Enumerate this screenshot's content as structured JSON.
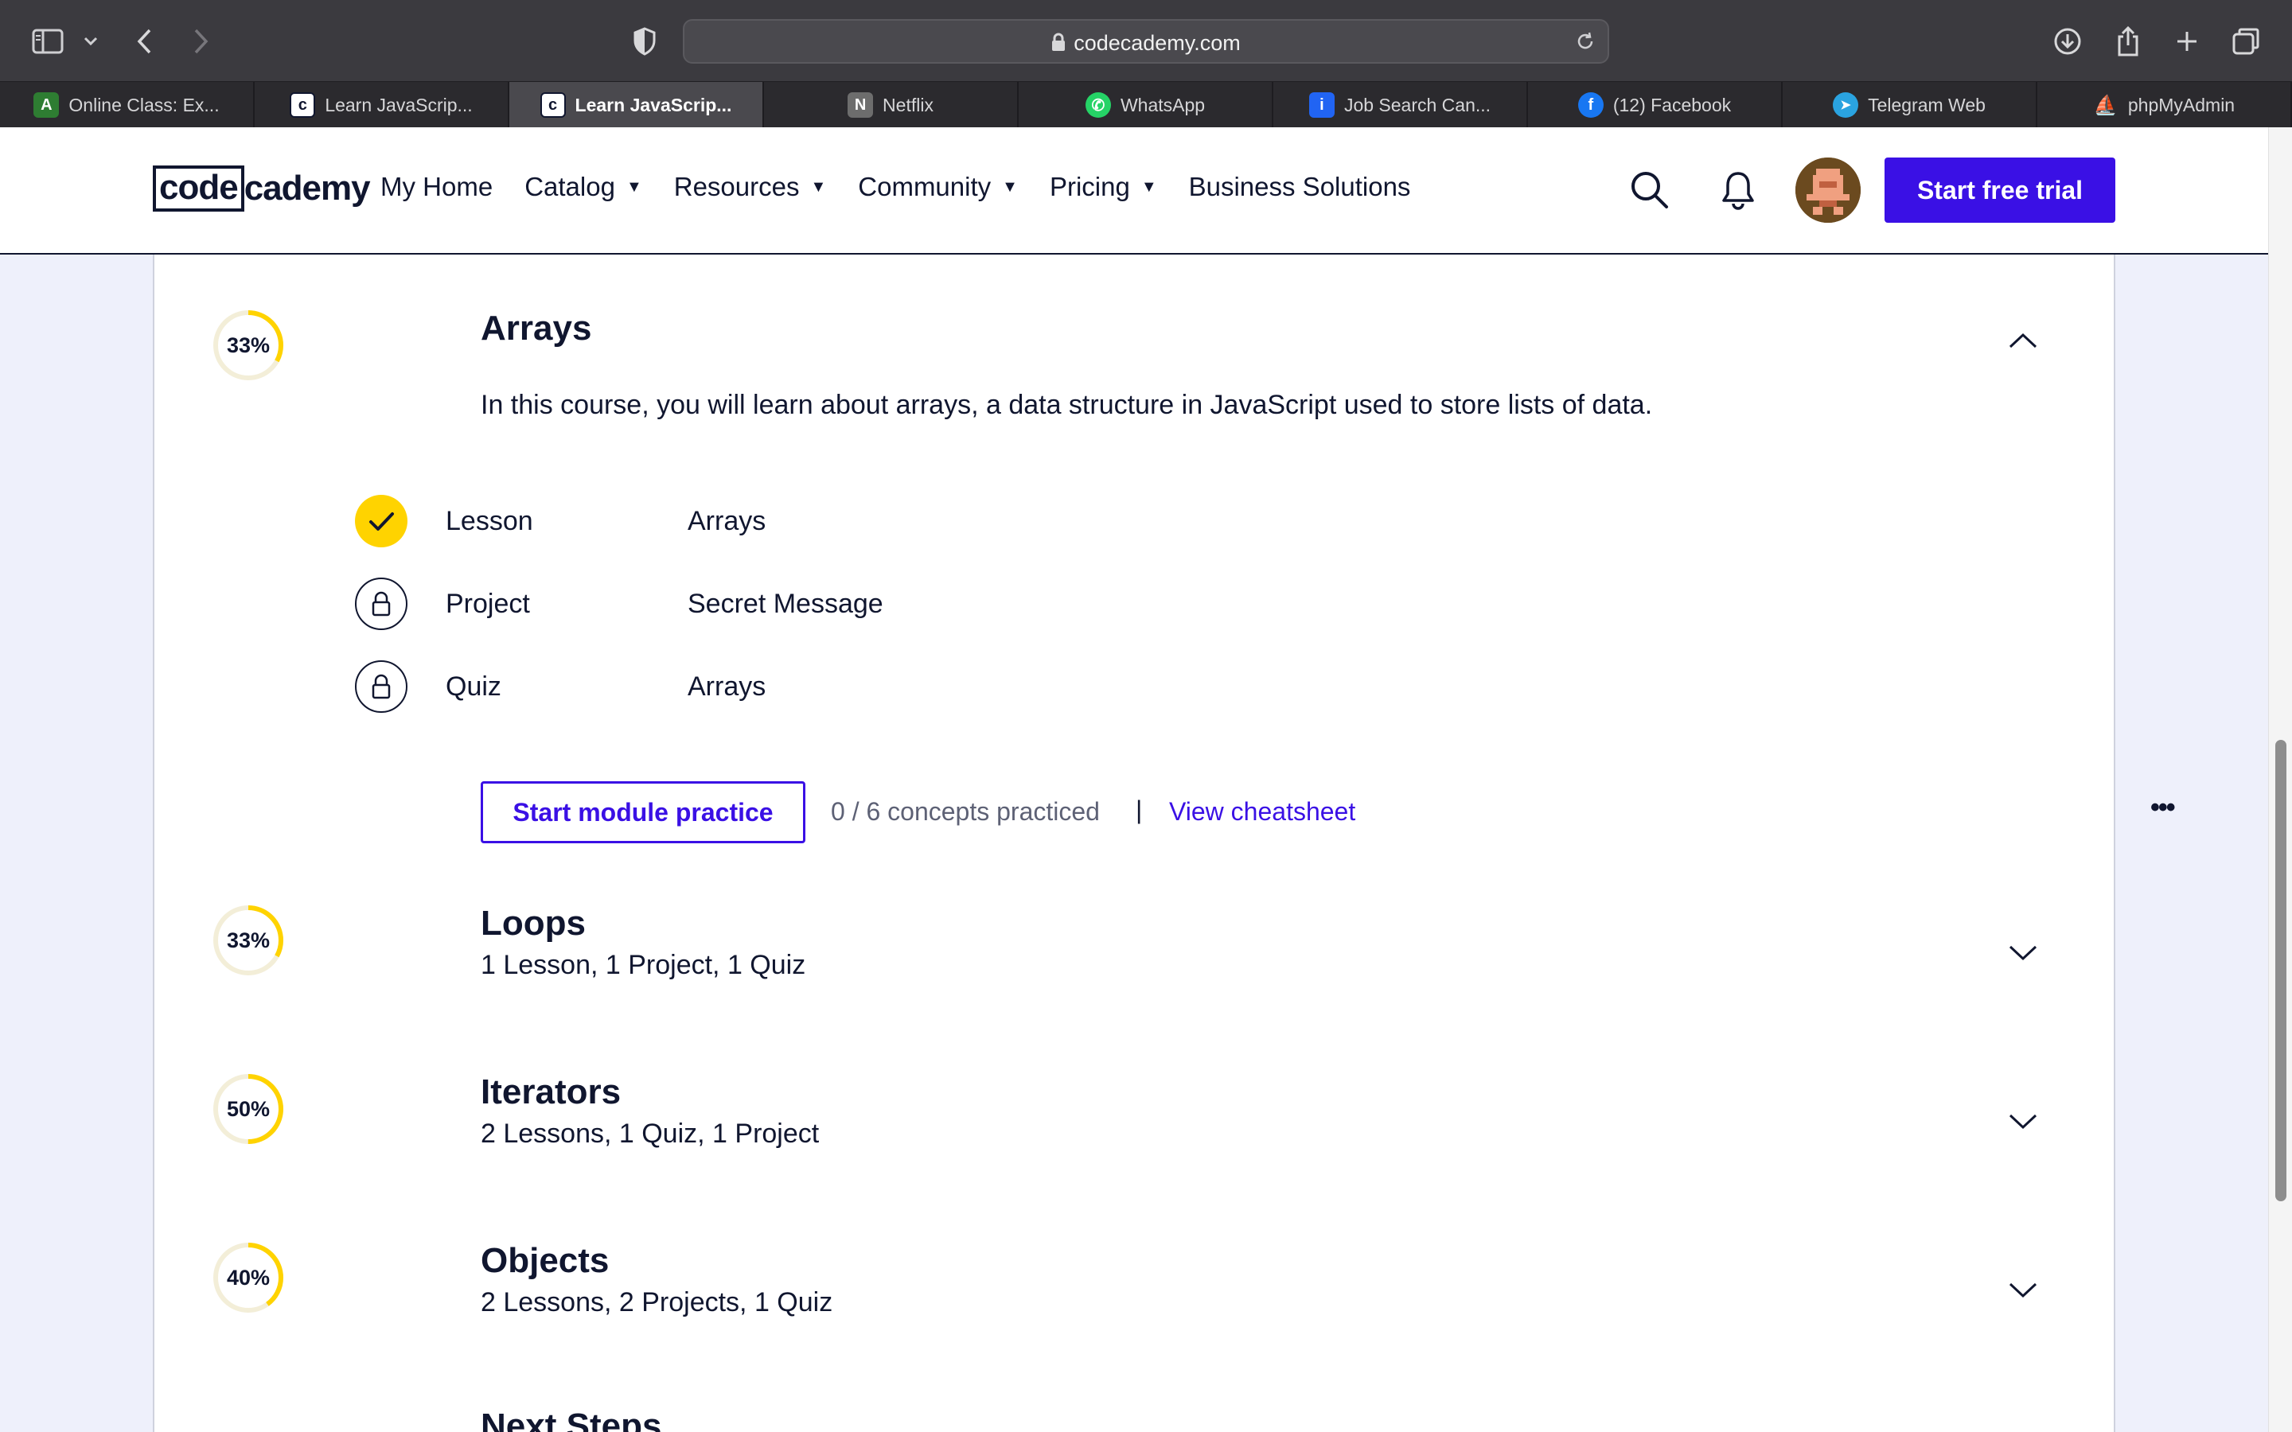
{
  "browser": {
    "url": "codecademy.com",
    "tabs": [
      {
        "label": "Online Class: Ex...",
        "favicon": "online-class-favicon",
        "color": "#2e7d32",
        "glyph": "A"
      },
      {
        "label": "Learn JavaScrip...",
        "favicon": "codecademy-favicon",
        "color": "#ffffff",
        "glyph": "c"
      },
      {
        "label": "Learn JavaScrip...",
        "favicon": "codecademy-favicon",
        "color": "#ffffff",
        "glyph": "c",
        "active": true
      },
      {
        "label": "Netflix",
        "favicon": "netflix-favicon",
        "color": "#6d6d6d",
        "glyph": "N"
      },
      {
        "label": "WhatsApp",
        "favicon": "whatsapp-favicon",
        "color": "#25d366",
        "glyph": "✆"
      },
      {
        "label": "Job Search Can...",
        "favicon": "indeed-favicon",
        "color": "#2164f3",
        "glyph": "i"
      },
      {
        "label": "(12) Facebook",
        "favicon": "facebook-favicon",
        "color": "#1877f2",
        "glyph": "f"
      },
      {
        "label": "Telegram Web",
        "favicon": "telegram-favicon",
        "color": "#2aa3e0",
        "glyph": "➤"
      },
      {
        "label": "phpMyAdmin",
        "favicon": "phpmyadmin-favicon",
        "color": "#f29111",
        "glyph": "⛵"
      }
    ]
  },
  "header": {
    "logo_left": "code",
    "logo_right": "cademy",
    "nav": [
      {
        "label": "My Home",
        "dropdown": false
      },
      {
        "label": "Catalog",
        "dropdown": true
      },
      {
        "label": "Resources",
        "dropdown": true
      },
      {
        "label": "Community",
        "dropdown": true
      },
      {
        "label": "Pricing",
        "dropdown": true
      },
      {
        "label": "Business Solutions",
        "dropdown": false
      }
    ],
    "cta_label": "Start free trial",
    "icons": [
      "search-icon",
      "bell-icon",
      "avatar"
    ]
  },
  "modules": [
    {
      "title": "Arrays",
      "progress": 0.33,
      "progress_label": "33%",
      "expanded": true,
      "description": "In this course, you will learn about arrays, a data structure in JavaScript used to store lists of data.",
      "items": [
        {
          "type": "Lesson",
          "name": "Arrays",
          "status": "completed"
        },
        {
          "type": "Project",
          "name": "Secret Message",
          "status": "locked"
        },
        {
          "type": "Quiz",
          "name": "Arrays",
          "status": "locked"
        }
      ],
      "practice_button": "Start module practice",
      "practice_count": "0 / 6 concepts practiced",
      "separator": "|",
      "cheatsheet_link": "View cheatsheet",
      "more_label": "•••"
    },
    {
      "title": "Loops",
      "progress": 0.33,
      "progress_label": "33%",
      "expanded": false,
      "summary": "1 Lesson, 1 Project, 1 Quiz"
    },
    {
      "title": "Iterators",
      "progress": 0.5,
      "progress_label": "50%",
      "expanded": false,
      "summary": "2 Lessons, 1 Quiz, 1 Project"
    },
    {
      "title": "Objects",
      "progress": 0.4,
      "progress_label": "40%",
      "expanded": false,
      "summary": "2 Lessons, 2 Projects, 1 Quiz"
    }
  ],
  "next_steps_label": "Next Steps",
  "colors": {
    "accent": "#3a10e5",
    "progress": "#ffd300",
    "progress_track": "#f3eed8",
    "navy": "#10162f",
    "page_bg": "#eef0fb"
  }
}
